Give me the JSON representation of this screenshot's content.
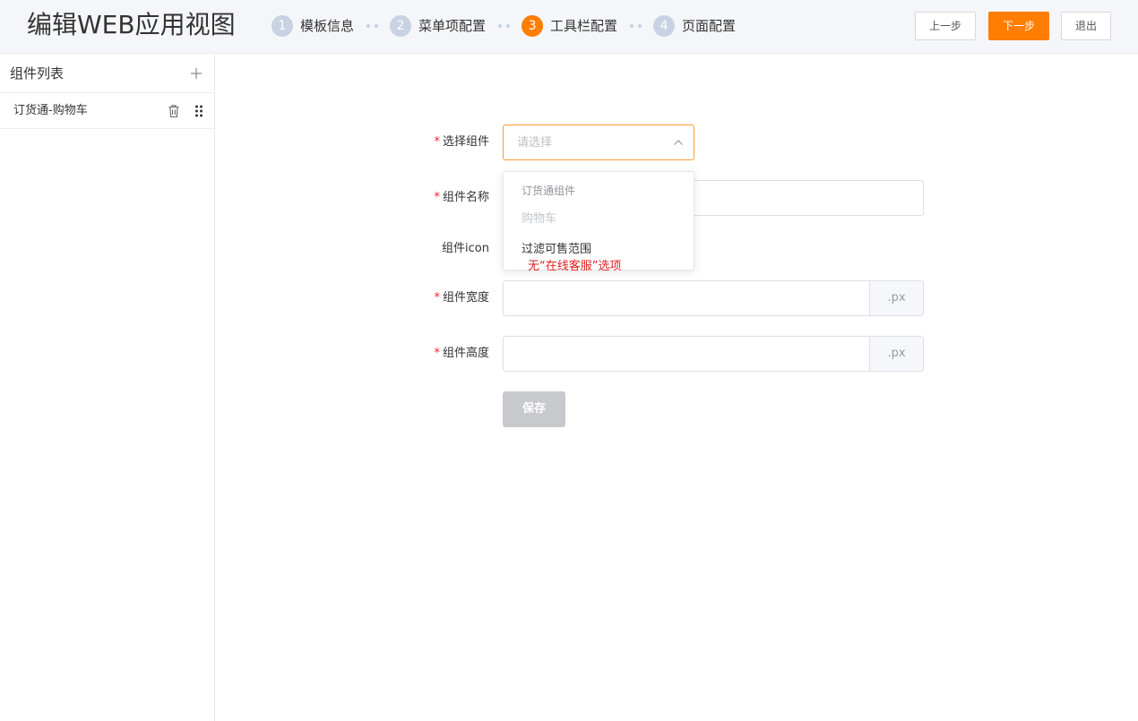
{
  "header": {
    "title": "编辑WEB应用视图",
    "steps": [
      {
        "num": "1",
        "label": "模板信息"
      },
      {
        "num": "2",
        "label": "菜单项配置"
      },
      {
        "num": "3",
        "label": "工具栏配置"
      },
      {
        "num": "4",
        "label": "页面配置"
      }
    ],
    "active_step": 3,
    "buttons": {
      "prev": "上一步",
      "next": "下一步",
      "exit": "退出"
    }
  },
  "sidebar": {
    "title": "组件列表",
    "items": [
      {
        "label": "订货通-购物车"
      }
    ]
  },
  "form": {
    "fields": {
      "component": {
        "label": "选择组件",
        "placeholder": "请选择",
        "required": true
      },
      "name": {
        "label": "组件名称",
        "value": "",
        "required": true
      },
      "icon": {
        "label": "组件icon",
        "required": false
      },
      "width": {
        "label": "组件宽度",
        "value": "",
        "suffix": ".px",
        "required": true
      },
      "height": {
        "label": "组件高度",
        "value": "",
        "suffix": ".px",
        "required": true
      }
    },
    "save_label": "保存"
  },
  "dropdown": {
    "group_label": "订货通组件",
    "options": [
      {
        "label": "购物车",
        "disabled": true
      },
      {
        "label": "过滤可售范围",
        "disabled": false
      }
    ]
  },
  "annotation": "无“在线客服”选项",
  "colors": {
    "accent": "#ff7d00",
    "step_inactive": "#c8d2e2",
    "annotation": "#e02020",
    "required": "#f5222d"
  }
}
